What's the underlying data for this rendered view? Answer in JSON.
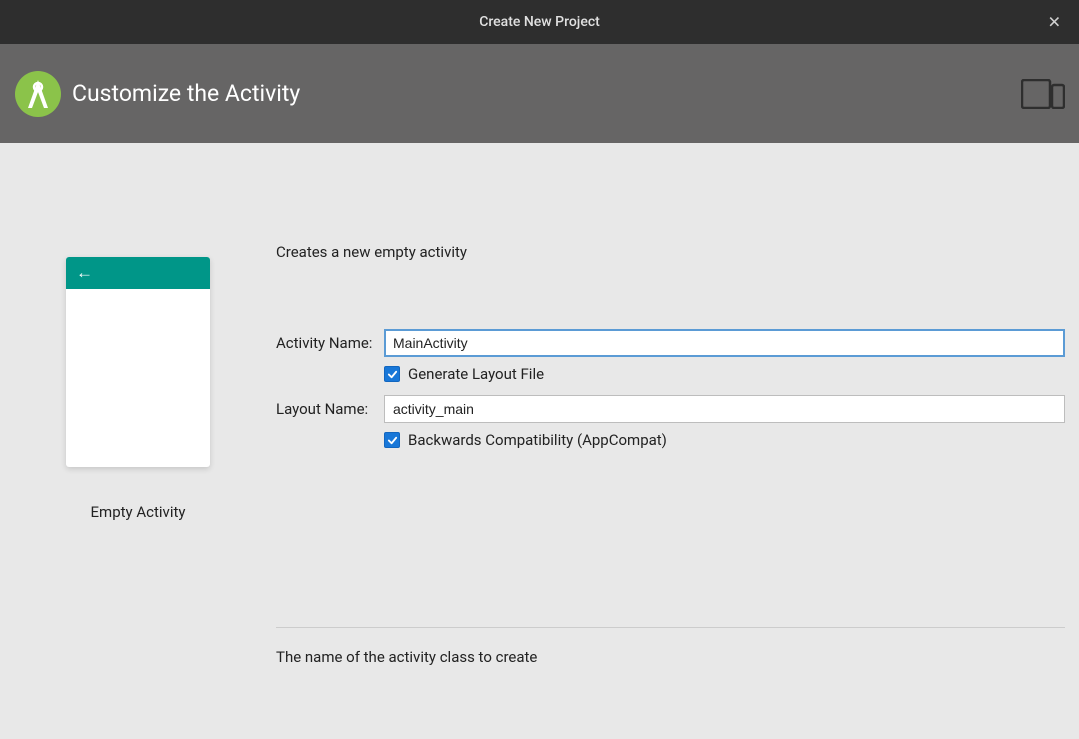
{
  "titlebar": {
    "title": "Create New Project"
  },
  "header": {
    "title": "Customize the Activity"
  },
  "preview": {
    "label": "Empty Activity"
  },
  "form": {
    "description": "Creates a new empty activity",
    "activity_name_label": "Activity Name:",
    "activity_name_value": "MainActivity",
    "generate_layout_label": "Generate Layout File",
    "generate_layout_checked": true,
    "layout_name_label": "Layout Name:",
    "layout_name_value": "activity_main",
    "backwards_compat_label": "Backwards Compatibility (AppCompat)",
    "backwards_compat_checked": true,
    "help_text": "The name of the activity class to create"
  }
}
